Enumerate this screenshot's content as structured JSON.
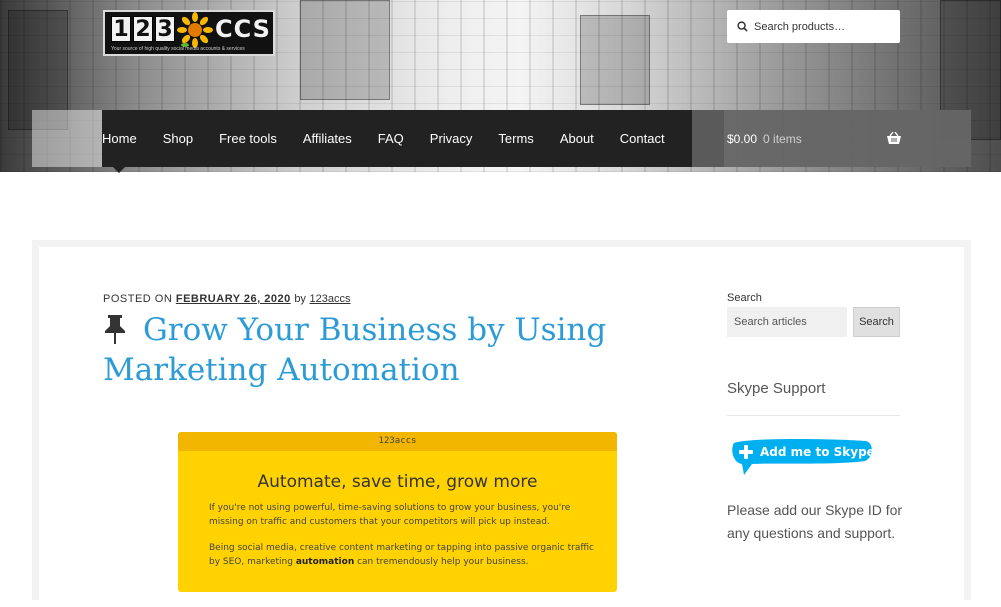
{
  "header": {
    "logo": {
      "digits": [
        "1",
        "2",
        "3"
      ],
      "suffix": "CCS",
      "tagline": "Your source of high quality social media accounts & services"
    },
    "search": {
      "placeholder": "Search products…",
      "icon": "search-icon"
    },
    "nav": [
      {
        "label": "Home",
        "active": true
      },
      {
        "label": "Shop"
      },
      {
        "label": "Free tools"
      },
      {
        "label": "Affiliates"
      },
      {
        "label": "FAQ"
      },
      {
        "label": "Privacy"
      },
      {
        "label": "Terms"
      },
      {
        "label": "About"
      },
      {
        "label": "Contact"
      }
    ],
    "cart": {
      "amount": "$0.00",
      "items": "0 items",
      "icon": "basket-icon"
    }
  },
  "post": {
    "posted_on_label": "POSTED ON",
    "date": "FEBRUARY 26, 2020",
    "by_label": "by",
    "author": "123accs",
    "sticky_icon": "pin-icon",
    "title": "Grow Your Business by Using Marketing Automation",
    "promo": {
      "top_label": "123accs",
      "heading": "Automate, save time, grow more",
      "paragraph1": "If you're not using powerful, time-saving solutions to grow your business, you're missing on traffic and customers that your competitors will pick up instead.",
      "paragraph2_before": "Being social media, creative content marketing or tapping into passive organic traffic by SEO, marketing ",
      "paragraph2_bold": "automation",
      "paragraph2_after": " can tremendously help your business."
    }
  },
  "sidebar": {
    "search_label": "Search",
    "search_placeholder": "Search articles",
    "search_button": "Search",
    "skype_heading": "Skype Support",
    "skype_badge": "Add me to Skype",
    "skype_note": "Please add our Skype ID for any questions and support."
  },
  "colors": {
    "nav_bg": "#222222",
    "title_blue": "#2c9bd6",
    "promo_yellow": "#ffd200",
    "promo_top": "#f2b600",
    "skype_blue": "#00aff0"
  }
}
